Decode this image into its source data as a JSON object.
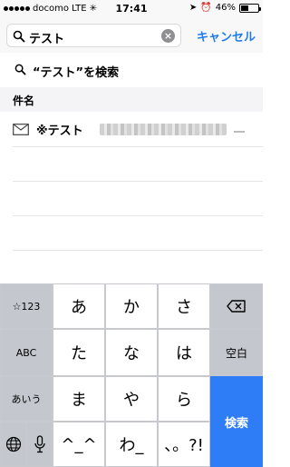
{
  "status_bar": {
    "carrier": "docomo",
    "network": "LTE",
    "time": "17:41",
    "battery": "46%",
    "battery_level": 0.46
  },
  "search": {
    "value": "テスト",
    "cancel_label": "キャンセル"
  },
  "suggestion": {
    "label": "“テスト”を検索"
  },
  "section": {
    "header": "件名"
  },
  "results": [
    {
      "title": "※テスト"
    }
  ],
  "keyboard": {
    "row1": [
      "☆123",
      "あ",
      "か",
      "さ"
    ],
    "row2": [
      "ABC",
      "た",
      "な",
      "は",
      "空白"
    ],
    "row3": [
      "あいう",
      "ま",
      "や",
      "ら"
    ],
    "row4": [
      "^_^",
      "わ_",
      "、。?!"
    ],
    "search_label": "検索"
  }
}
